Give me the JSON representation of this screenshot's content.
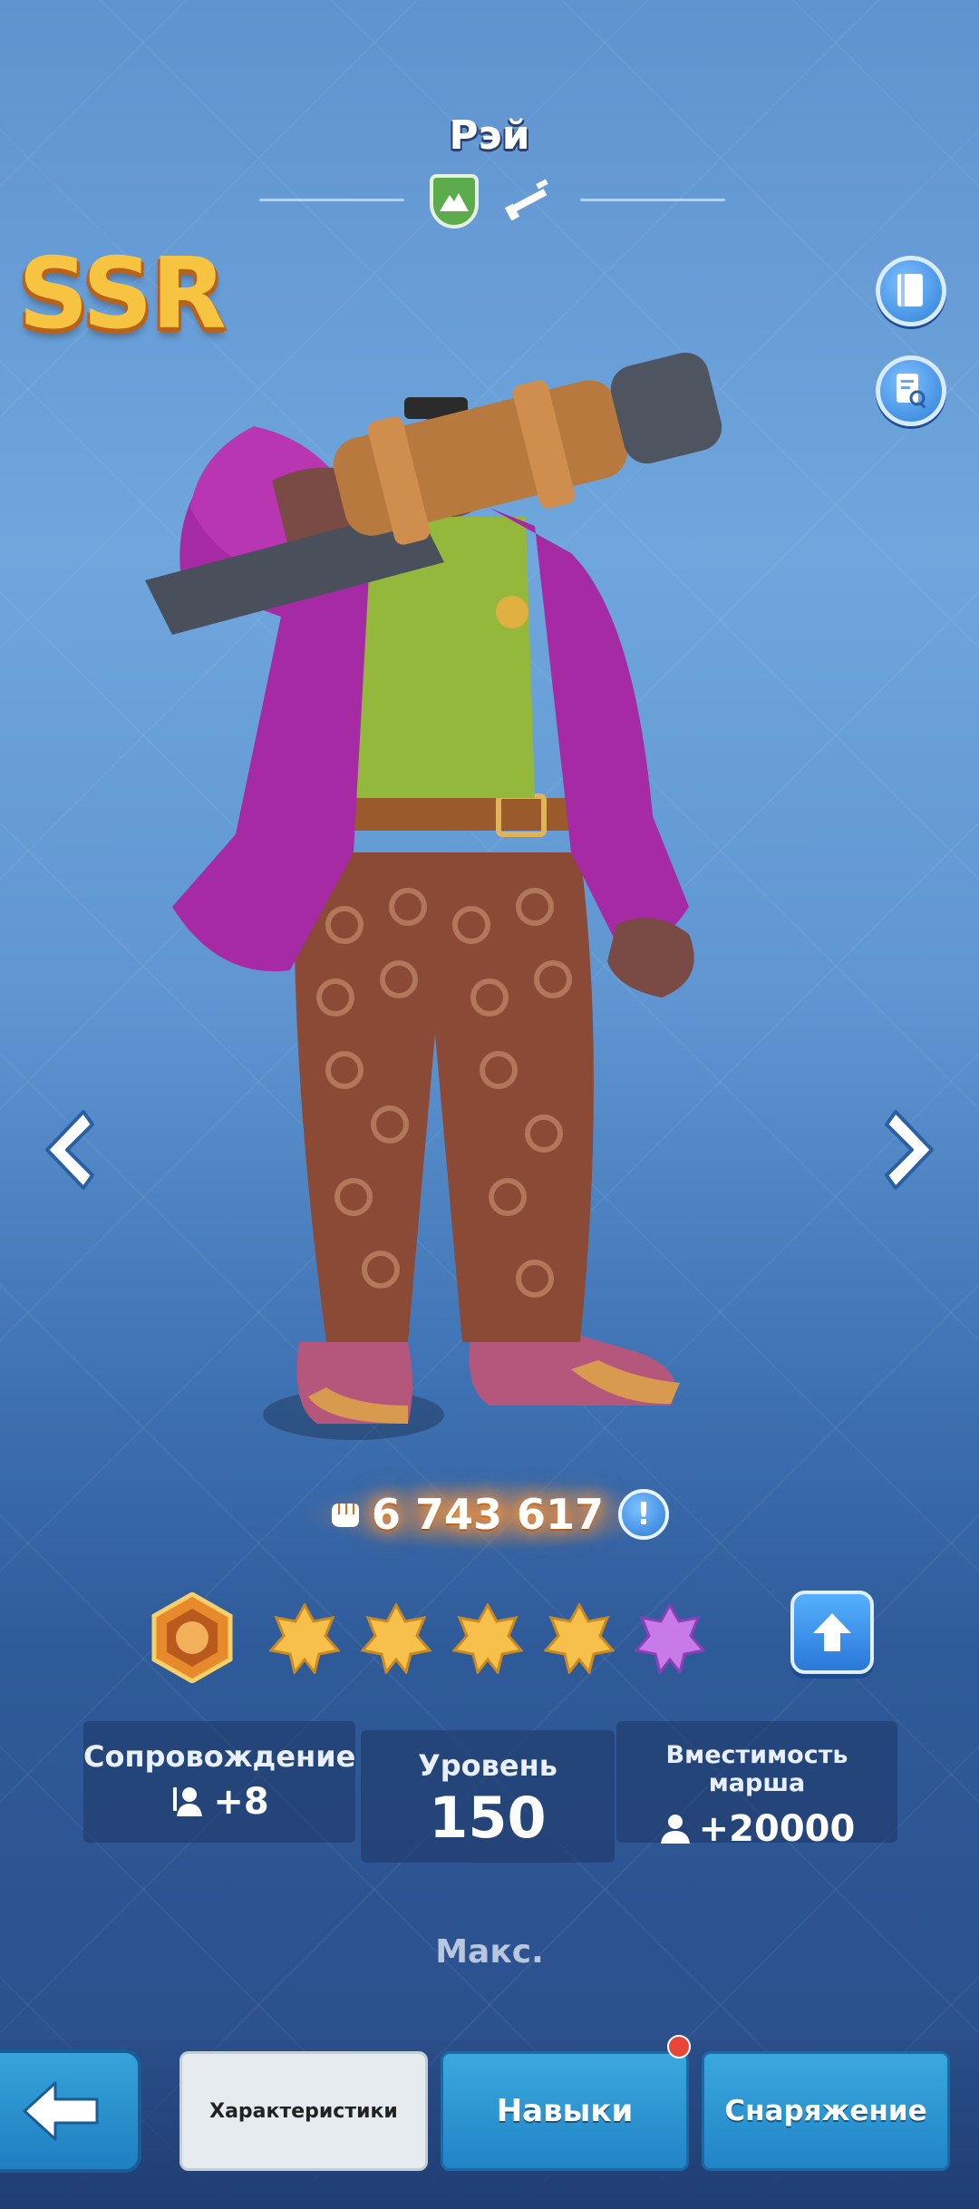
{
  "hero": {
    "name": "Рэй",
    "rarity": "SSR",
    "faction_icon": "mountain-faction-icon",
    "weapon_icon": "rifle-icon"
  },
  "side_buttons": {
    "encyclopedia_icon": "book-icon",
    "details_icon": "document-search-icon"
  },
  "navigation": {
    "prev_icon": "chevron-left-icon",
    "next_icon": "chevron-right-icon"
  },
  "power": {
    "icon": "fist-icon",
    "value": "6 743 617",
    "info_label": "!"
  },
  "stars": {
    "total": 5,
    "filled_gold": 4,
    "filled_purple": 1,
    "badge_icon": "star-badge-icon",
    "upgrade_icon": "arrow-up-icon"
  },
  "stats": {
    "escort": {
      "label": "Сопровождение",
      "value": "+8",
      "icon": "escort-icon"
    },
    "level": {
      "label": "Уровень",
      "value": "150"
    },
    "capacity": {
      "label": "Вместимость марша",
      "value": "+20000",
      "icon": "person-icon"
    }
  },
  "max_label": "Макс.",
  "tabs": [
    {
      "label": "Характеристики",
      "active": true
    },
    {
      "label": "Навыки",
      "active": false,
      "notification": true
    },
    {
      "label": "Снаряжение",
      "active": false
    }
  ],
  "colors": {
    "rarity_gold": "#f7c442",
    "accent_blue": "#2f7fd8",
    "notification_red": "#e8463a"
  }
}
